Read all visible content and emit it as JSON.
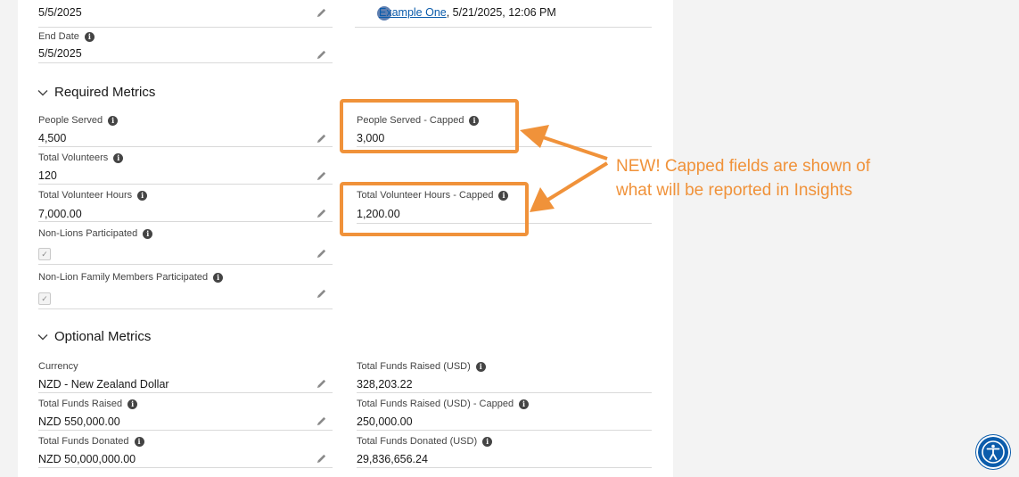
{
  "top": {
    "partial_value": "5/5/2025",
    "created_by_link": "Example One",
    "created_by_rest": ", 5/21/2025, 12:06 PM"
  },
  "end_date": {
    "label": "End Date",
    "value": "5/5/2025"
  },
  "required_metrics": {
    "title": "Required Metrics",
    "people_served": {
      "label": "People Served",
      "value": "4,500"
    },
    "people_served_capped": {
      "label": "People Served - Capped",
      "value": "3,000"
    },
    "total_volunteers": {
      "label": "Total Volunteers",
      "value": "120"
    },
    "total_volunteer_hours": {
      "label": "Total Volunteer Hours",
      "value": "7,000.00"
    },
    "total_volunteer_hours_capped": {
      "label": "Total Volunteer Hours - Capped",
      "value": "1,200.00"
    },
    "non_lions_participated": {
      "label": "Non-Lions Participated",
      "checked": true
    },
    "non_lion_family_participated": {
      "label": "Non-Lion Family Members Participated",
      "checked": true
    }
  },
  "optional_metrics": {
    "title": "Optional Metrics",
    "currency": {
      "label": "Currency",
      "value": "NZD - New Zealand Dollar"
    },
    "total_funds_raised_usd": {
      "label": "Total Funds Raised (USD)",
      "value": "328,203.22"
    },
    "total_funds_raised": {
      "label": "Total Funds Raised",
      "value": "NZD 550,000.00"
    },
    "total_funds_raised_usd_capped": {
      "label": "Total Funds Raised (USD) - Capped",
      "value": "250,000.00"
    },
    "total_funds_donated": {
      "label": "Total Funds Donated",
      "value": "NZD 50,000,000.00"
    },
    "total_funds_donated_usd": {
      "label": "Total Funds Donated (USD)",
      "value": "29,836,656.24"
    }
  },
  "annotation": {
    "text": "NEW!  Capped fields are shown of what will be reported in Insights",
    "color": "#f0923a"
  },
  "icons": {
    "info": "info-icon",
    "edit": "pencil-icon",
    "section": "chevron-down-icon",
    "accessibility": "accessibility-icon"
  }
}
